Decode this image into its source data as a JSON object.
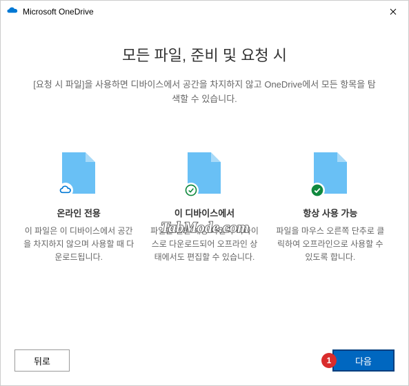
{
  "window": {
    "title": "Microsoft OneDrive"
  },
  "main": {
    "heading": "모든 파일, 준비 및 요청 시",
    "description": "[요청 시 파일]을 사용하면 디바이스에서 공간을 차지하지 않고 OneDrive에서 모든 항목을 탐색할 수 있습니다."
  },
  "columns": {
    "online": {
      "title": "온라인 전용",
      "desc": "이 파일은 이 디바이스에서 공간을 차지하지 않으며 사용할 때 다운로드됩니다."
    },
    "device": {
      "title": "이 디바이스에서",
      "desc": "파일을 열면 해당 파일이 디바이스로 다운로드되어 오프라인 상태에서도 편집할 수 있습니다."
    },
    "always": {
      "title": "항상 사용 가능",
      "desc": "파일을 마우스 오른쪽 단추로 클릭하여 오프라인으로 사용할 수 있도록 합니다."
    }
  },
  "footer": {
    "back": "뒤로",
    "next": "다음"
  },
  "watermark": "TabMode.com",
  "annotation": "1"
}
